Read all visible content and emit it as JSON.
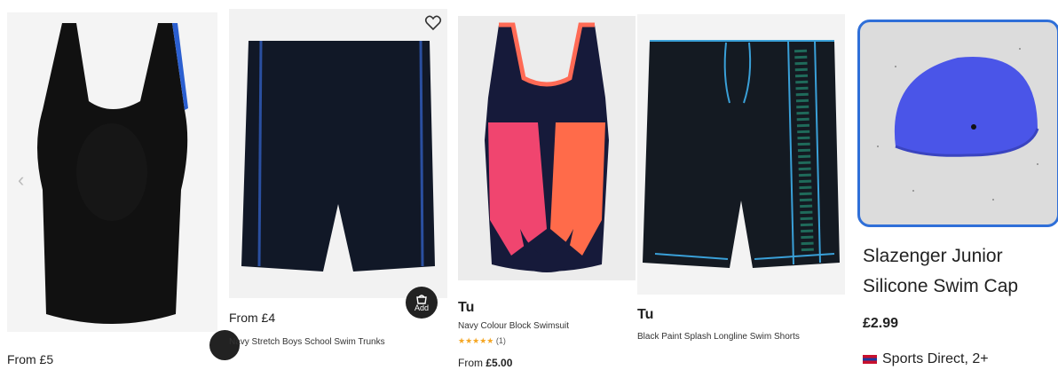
{
  "products": [
    {
      "price": "From £5"
    },
    {
      "price": "From £4",
      "title": "Navy Stretch Boys School Swim Trunks",
      "add_label": "Add"
    },
    {
      "brand": "Tu",
      "title": "Navy Colour Block Swimsuit",
      "stars": "★★★★★",
      "rating_count": "(1)",
      "price_prefix": "From ",
      "price_value": "£5.00"
    },
    {
      "brand": "Tu",
      "title": "Black Paint Splash Longline Swim Shorts"
    },
    {
      "title_line1": "Slazenger Junior",
      "title_line2": "Silicone Swim Cap",
      "price": "£2.99",
      "seller": "Sports Direct, 2+"
    }
  ],
  "carousel": {
    "prev_arrow": "‹"
  },
  "colors": {
    "accent_blue": "#2f6fd8",
    "star": "#f5a623",
    "cap": "#4a55e8"
  }
}
